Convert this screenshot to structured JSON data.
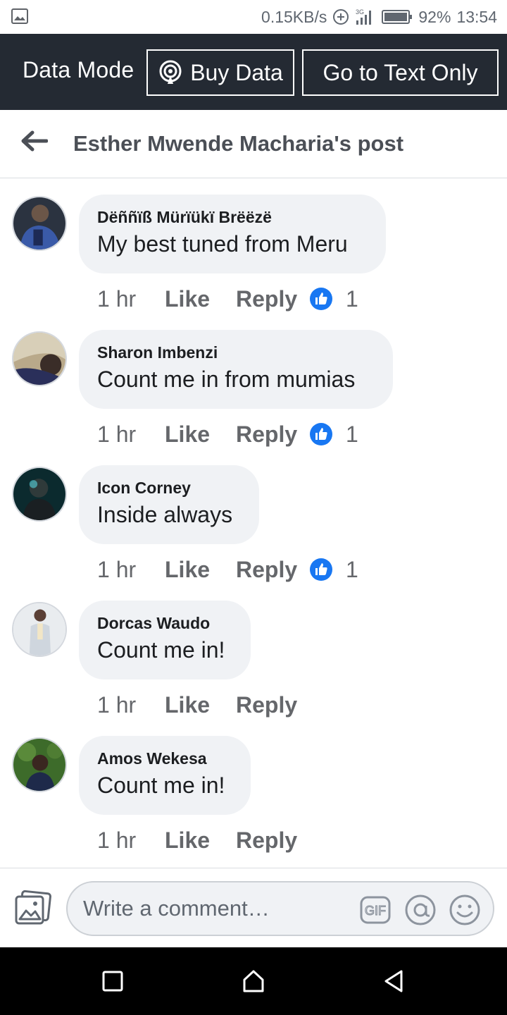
{
  "status_bar": {
    "net_speed": "0.15KB/s",
    "network_type": "3G",
    "battery": "92%",
    "time": "13:54"
  },
  "data_banner": {
    "mode_label": "Data Mode",
    "buy_data_label": "Buy Data",
    "text_only_label": "Go to Text Only"
  },
  "header": {
    "title": "Esther Mwende Macharia's post"
  },
  "comments": [
    {
      "author": "Dëññïß Mürïükï Brëëzë",
      "text": "My best tuned from Meru",
      "time": "1 hr",
      "like": "Like",
      "reply": "Reply",
      "reactions": "1"
    },
    {
      "author": "Sharon Imbenzi",
      "text": "Count me in from mumias",
      "time": "1 hr",
      "like": "Like",
      "reply": "Reply",
      "reactions": "1"
    },
    {
      "author": "Icon Corney",
      "text": "Inside always",
      "time": "1 hr",
      "like": "Like",
      "reply": "Reply",
      "reactions": "1"
    },
    {
      "author": "Dorcas Waudo",
      "text": "Count me in!",
      "time": "1 hr",
      "like": "Like",
      "reply": "Reply"
    },
    {
      "author": "Amos Wekesa",
      "text": "Count me in!",
      "time": "1 hr",
      "like": "Like",
      "reply": "Reply"
    }
  ],
  "composer": {
    "placeholder": "Write a comment…",
    "gif_label": "GIF"
  },
  "colors": {
    "banner_bg": "#242a33",
    "bubble_bg": "#f0f2f5",
    "like_blue": "#1877f2"
  }
}
